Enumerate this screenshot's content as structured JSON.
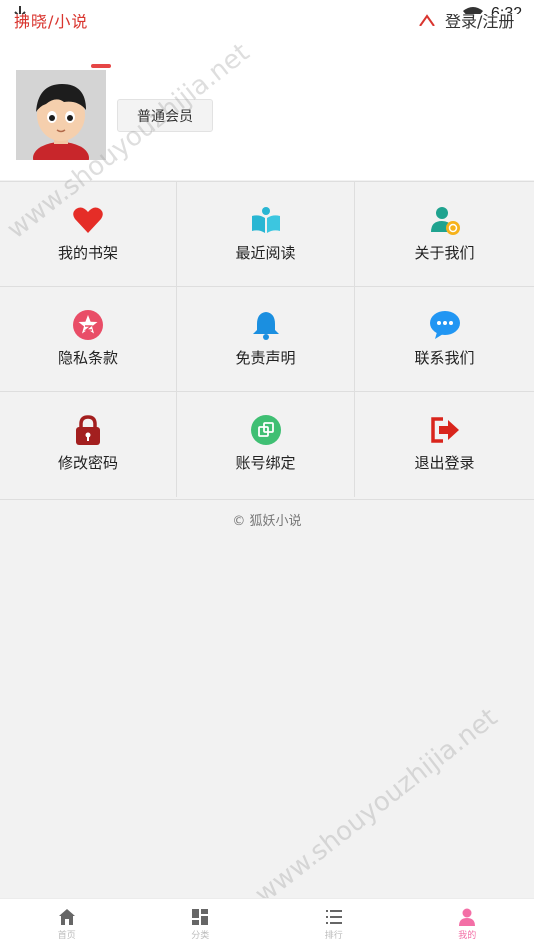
{
  "status_bar": {
    "time": "6:32",
    "icons": [
      "download-icon",
      "wifi-icon"
    ]
  },
  "app_bar": {
    "left_text": "拂晓/小说",
    "right_text": "登录/注册",
    "right_icon": "user-icon"
  },
  "profile": {
    "avatar": "avatar",
    "member_level": "普通会员"
  },
  "menu": {
    "items": [
      {
        "label": "我的书架",
        "icon": "heart-icon",
        "color": "#e52d27"
      },
      {
        "label": "最近阅读",
        "icon": "book-icon",
        "color": "#29b6d3"
      },
      {
        "label": "关于我们",
        "icon": "user-info-icon",
        "color": "#1fa38f"
      },
      {
        "label": "隐私条款",
        "icon": "star-badge-icon",
        "color": "#e94d67"
      },
      {
        "label": "免责声明",
        "icon": "bell-icon",
        "color": "#1b8fe0"
      },
      {
        "label": "联系我们",
        "icon": "chat-icon",
        "color": "#2196f3"
      },
      {
        "label": "修改密码",
        "icon": "lock-icon",
        "color": "#a31f1f"
      },
      {
        "label": "账号绑定",
        "icon": "link-icon",
        "color": "#3fbf73"
      },
      {
        "label": "退出登录",
        "icon": "logout-icon",
        "color": "#d9251c"
      }
    ]
  },
  "footer": {
    "copyright": "© 狐妖小说"
  },
  "tabs": [
    {
      "label": "首页",
      "icon": "home-icon",
      "active": false
    },
    {
      "label": "分类",
      "icon": "category-icon",
      "active": false
    },
    {
      "label": "排行",
      "icon": "ranking-icon",
      "active": false
    },
    {
      "label": "我的",
      "icon": "profile-icon",
      "active": true
    }
  ],
  "colors": {
    "accent": "#f36fa6",
    "brand_red": "#e52d27",
    "background": "#f2f2f2"
  },
  "watermark": "www.shouyouzhijia.net"
}
